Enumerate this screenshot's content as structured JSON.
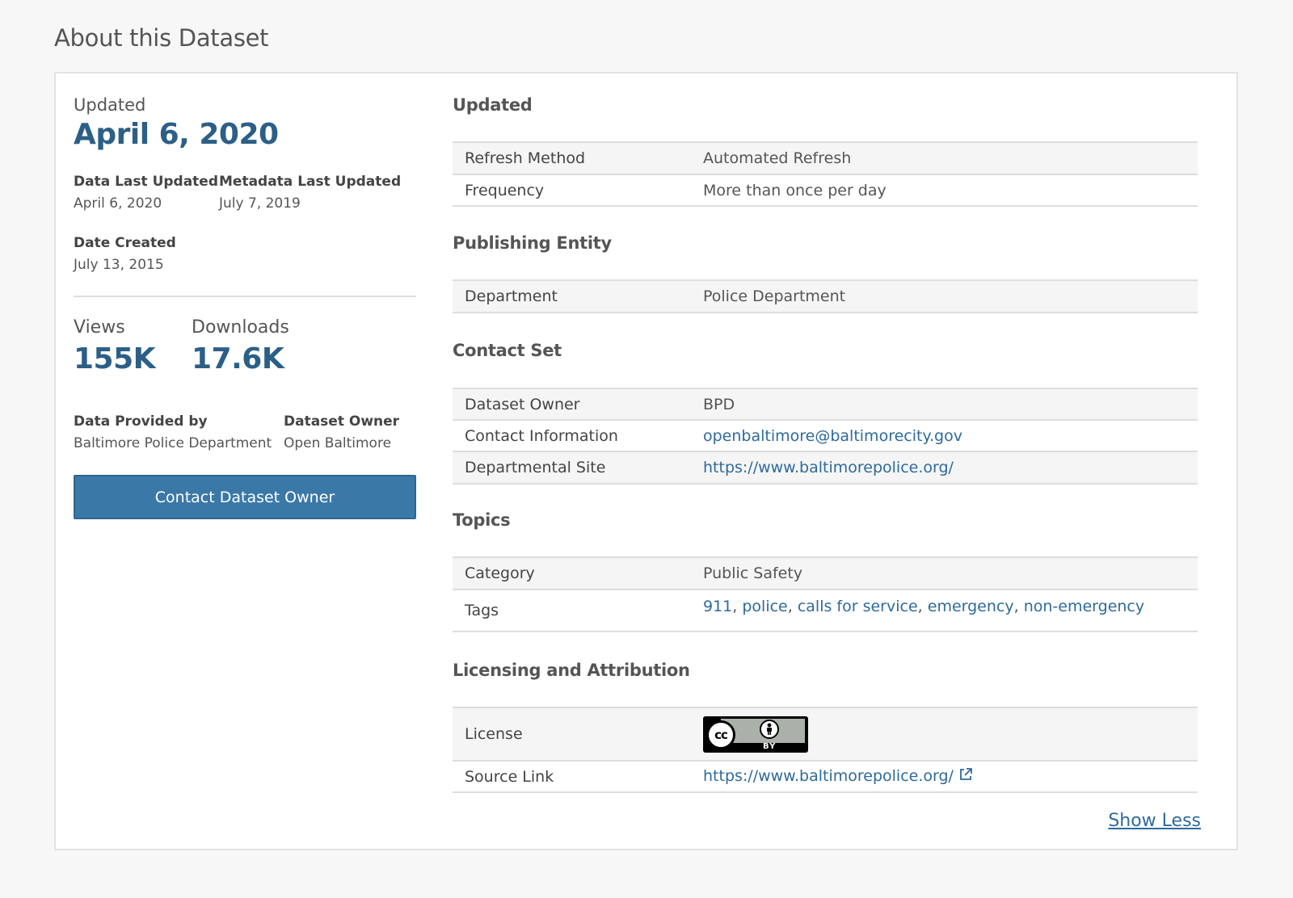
{
  "page": {
    "title": "About this Dataset"
  },
  "summary": {
    "updated_label": "Updated",
    "updated_date": "April 6, 2020",
    "data_last_updated_label": "Data Last Updated",
    "data_last_updated_value": "April 6, 2020",
    "metadata_last_updated_label": "Metadata Last Updated",
    "metadata_last_updated_value": "July 7, 2019",
    "date_created_label": "Date Created",
    "date_created_value": "July 13, 2015",
    "views_label": "Views",
    "views_value": "155K",
    "downloads_label": "Downloads",
    "downloads_value": "17.6K",
    "data_provided_by_label": "Data Provided by",
    "data_provided_by_value": "Baltimore Police Department",
    "dataset_owner_label": "Dataset Owner",
    "dataset_owner_value": "Open Baltimore",
    "contact_button": "Contact Dataset Owner"
  },
  "sections": {
    "updated": {
      "title": "Updated",
      "rows": [
        {
          "key": "Refresh Method",
          "value": "Automated Refresh"
        },
        {
          "key": "Frequency",
          "value": "More than once per day"
        }
      ]
    },
    "publishing": {
      "title": "Publishing Entity",
      "rows": [
        {
          "key": "Department",
          "value": "Police Department"
        }
      ]
    },
    "contact": {
      "title": "Contact Set",
      "rows": [
        {
          "key": "Dataset Owner",
          "value": "BPD"
        },
        {
          "key": "Contact Information",
          "value": "openbaltimore@baltimorecity.gov"
        },
        {
          "key": "Departmental Site",
          "value": "https://www.baltimorepolice.org/"
        }
      ]
    },
    "topics": {
      "title": "Topics",
      "rows": [
        {
          "key": "Category",
          "value": "Public Safety"
        },
        {
          "key": "Tags",
          "tags": [
            "911",
            "police",
            "calls for service",
            "emergency",
            "non-emergency"
          ]
        }
      ]
    },
    "licensing": {
      "title": "Licensing and Attribution",
      "rows": [
        {
          "key": "License",
          "badge": {
            "cc": "cc",
            "by": "BY"
          }
        },
        {
          "key": "Source Link",
          "value": "https://www.baltimorepolice.org/"
        }
      ]
    }
  },
  "footer": {
    "show_less": "Show Less"
  },
  "colors": {
    "accent": "#2c5f87",
    "button": "#3a78a8",
    "link": "#2e6a9c"
  }
}
